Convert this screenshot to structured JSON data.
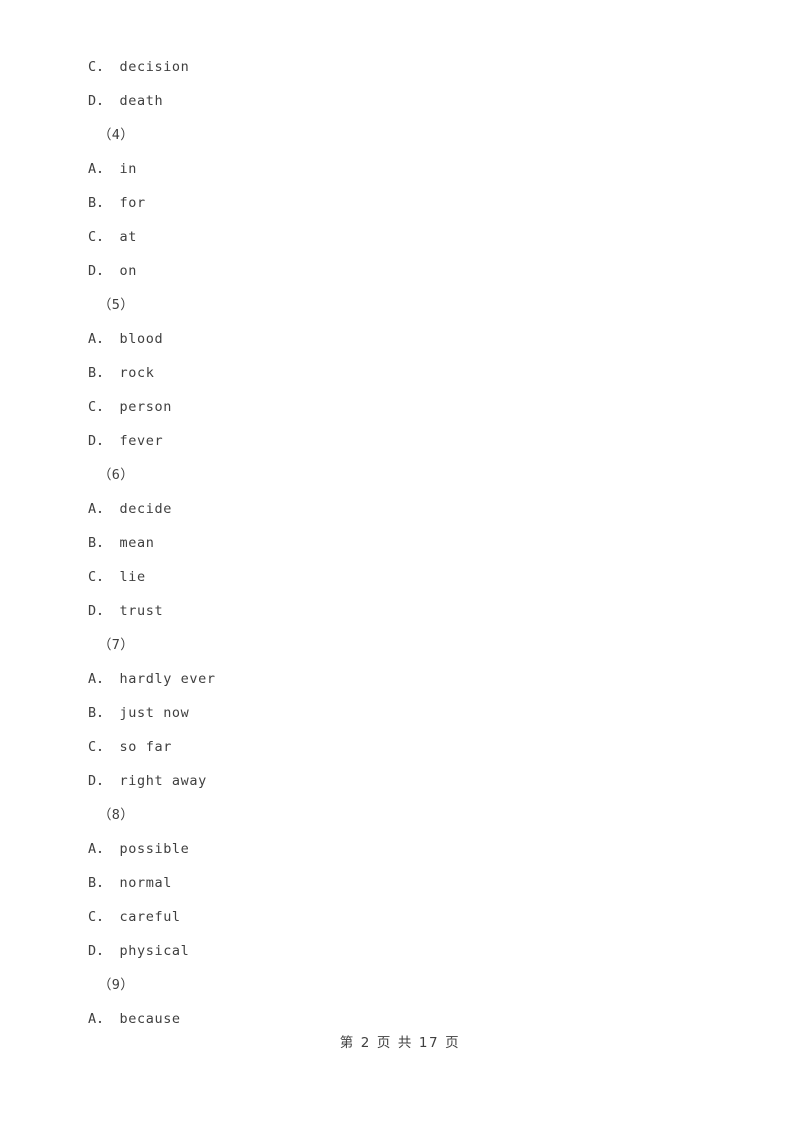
{
  "document": {
    "background_color": "#ffffff",
    "text_color": "#3f3f3f",
    "lines": [
      {
        "kind": "option",
        "text": "C． decision"
      },
      {
        "kind": "option",
        "text": "D． death"
      },
      {
        "kind": "group",
        "text": "（4）"
      },
      {
        "kind": "option",
        "text": "A． in"
      },
      {
        "kind": "option",
        "text": "B． for"
      },
      {
        "kind": "option",
        "text": "C． at"
      },
      {
        "kind": "option",
        "text": "D． on"
      },
      {
        "kind": "group",
        "text": "（5）"
      },
      {
        "kind": "option",
        "text": "A． blood"
      },
      {
        "kind": "option",
        "text": "B． rock"
      },
      {
        "kind": "option",
        "text": "C． person"
      },
      {
        "kind": "option",
        "text": "D． fever"
      },
      {
        "kind": "group",
        "text": "（6）"
      },
      {
        "kind": "option",
        "text": "A． decide"
      },
      {
        "kind": "option",
        "text": "B． mean"
      },
      {
        "kind": "option",
        "text": "C． lie"
      },
      {
        "kind": "option",
        "text": "D． trust"
      },
      {
        "kind": "group",
        "text": "（7）"
      },
      {
        "kind": "option",
        "text": "A． hardly ever"
      },
      {
        "kind": "option",
        "text": "B． just now"
      },
      {
        "kind": "option",
        "text": "C． so far"
      },
      {
        "kind": "option",
        "text": "D． right away"
      },
      {
        "kind": "group",
        "text": "（8）"
      },
      {
        "kind": "option",
        "text": "A． possible"
      },
      {
        "kind": "option",
        "text": "B． normal"
      },
      {
        "kind": "option",
        "text": "C． careful"
      },
      {
        "kind": "option",
        "text": "D． physical"
      },
      {
        "kind": "group",
        "text": "（9）"
      },
      {
        "kind": "option",
        "text": "A． because"
      }
    ]
  },
  "footer": {
    "text": "第 2 页 共 17 页",
    "current_page": "2",
    "total_pages": "17"
  }
}
